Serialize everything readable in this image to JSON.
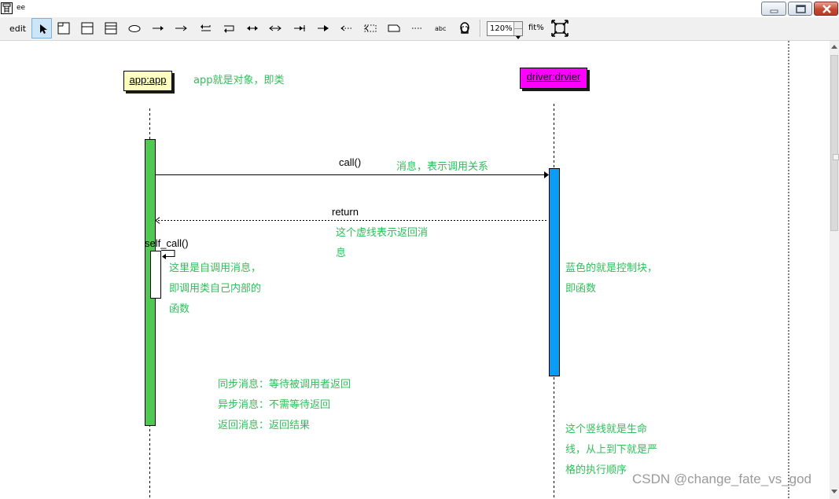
{
  "window": {
    "title": "ee",
    "controls": [
      "minimize-icon",
      "maximize-icon",
      "close-icon"
    ]
  },
  "toolbar": {
    "edit_label": "edit",
    "tools": [
      "select-arrow-icon",
      "object-box-icon",
      "class-box-icon",
      "list-box-icon",
      "ellipse-icon",
      "sync-message-icon",
      "async-message-icon",
      "return-left-icon",
      "self-return-icon",
      "bidirectional-icon",
      "bidirectional-open-icon",
      "reverse-arrow-icon",
      "open-arrow-icon",
      "dotted-left-icon",
      "dotted-box-icon",
      "note-icon",
      "dots-icon",
      "text-abc-icon",
      "person-icon"
    ],
    "abc_label": "abc",
    "zoom_value": "120%",
    "fit_label": "fit%"
  },
  "diagram": {
    "objects": {
      "app": "app:app",
      "driver": "driver:drvier"
    },
    "messages": {
      "call": "call()",
      "return": "return",
      "self_call": "self_call()"
    },
    "notes": {
      "object_note": "app就是对象，即类",
      "message_note": "消息，表示调用关系",
      "return_note": [
        "这个虚线表示返回消",
        "息"
      ],
      "self_call_note": [
        "这里是自调用消息，",
        "即调用类自己内部的",
        "函数"
      ],
      "control_note": [
        "蓝色的就是控制块，",
        "即函数"
      ],
      "message_types": [
        "同步消息：等待被调用者返回",
        "异步消息：不需等待返回",
        "返回消息：返回结果"
      ],
      "lifeline_note": [
        "这个竖线就是生命",
        "线，从上到下就是严",
        "格的执行顺序"
      ]
    },
    "colors": {
      "app_activation": "#4fc94f",
      "driver_activation": "#0b9cf5",
      "app_object": "#ffffc0",
      "driver_object": "#ff00ff",
      "note_text": "#2fbf5a"
    }
  },
  "watermark": "CSDN @change_fate_vs_god"
}
